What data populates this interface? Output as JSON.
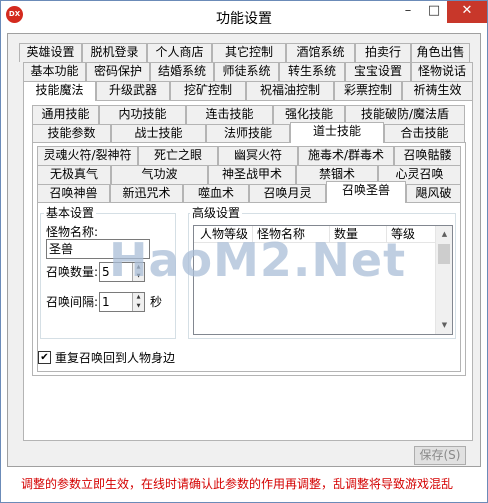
{
  "window": {
    "title": "功能设置",
    "icon_text": "DX",
    "controls": {
      "minimize": "–",
      "maximize": "□",
      "close": "✕"
    }
  },
  "tabs": {
    "row1": [
      "英雄设置",
      "脱机登录",
      "个人商店",
      "其它控制",
      "酒馆系统",
      "拍卖行",
      "角色出售"
    ],
    "row2": [
      "基本功能",
      "密码保护",
      "结婚系统",
      "师徒系统",
      "转生系统",
      "宝宝设置",
      "怪物说话"
    ],
    "row3": [
      "技能魔法",
      "升级武器",
      "挖矿控制",
      "祝福油控制",
      "彩票控制",
      "祈祷生效"
    ],
    "row4": [
      "通用技能",
      "内功技能",
      "连击技能",
      "强化技能",
      "技能破防/魔法盾"
    ],
    "row5": [
      "技能参数",
      "战士技能",
      "法师技能",
      "道士技能",
      "合击技能"
    ],
    "row6": [
      "灵魂火符/裂神符",
      "死亡之眼",
      "幽冥火符",
      "施毒术/群毒术",
      "召唤骷髅"
    ],
    "row7": [
      "无极真气",
      "气功波",
      "神圣战甲术",
      "禁锢术",
      "心灵召唤"
    ],
    "row8": [
      "召唤神兽",
      "新迅咒术",
      "噬血术",
      "召唤月灵",
      "召唤圣兽",
      "飓风破"
    ]
  },
  "basic_settings": {
    "label": "基本设置",
    "monster_name_label": "怪物名称:",
    "monster_name_value": "圣兽",
    "summon_count_label": "召唤数量:",
    "summon_count_value": "5",
    "summon_interval_label": "召唤间隔:",
    "summon_interval_value": "1",
    "seconds_unit": "秒"
  },
  "advanced_settings": {
    "label": "高级设置",
    "columns": [
      "人物等级",
      "怪物名称",
      "数量",
      "等级"
    ]
  },
  "resummon_checkbox": {
    "label": "重复召唤回到人物身边",
    "checked": true,
    "mark": "✔"
  },
  "save_button": "保存(S)",
  "notice": "调整的参数立即生效，在线时请确认此参数的作用再调整，乱调整将导致游戏混乱",
  "watermark": "HaoM2.Net"
}
